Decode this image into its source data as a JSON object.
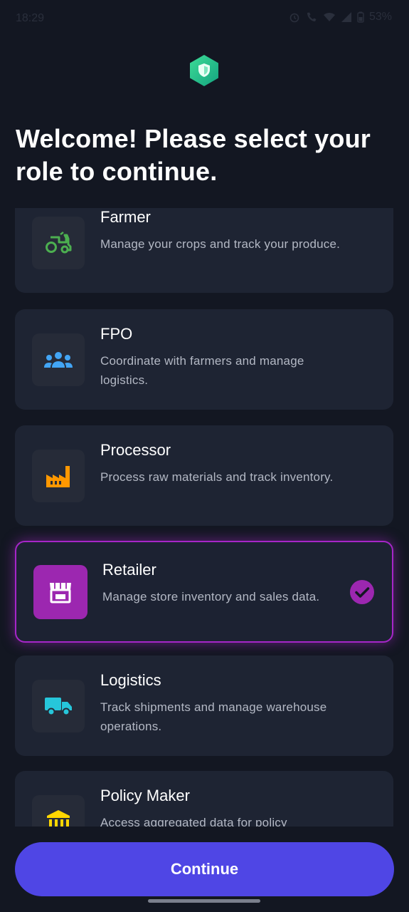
{
  "status_bar": {
    "time": "18:29",
    "battery": "53%",
    "icons": [
      "snapchat-icon",
      "alarm-icon",
      "wifi-call-icon",
      "wifi-icon",
      "signal-icon",
      "battery-icon"
    ]
  },
  "header": {
    "logo_icon": "shield-logo-icon",
    "title": "Welcome! Please select your role to continue."
  },
  "roles": [
    {
      "title": "Farmer",
      "description": "Manage your crops and track your produce.",
      "icon": "tractor-icon",
      "icon_color": "#4caf50",
      "selected": false
    },
    {
      "title": "FPO",
      "description": "Coordinate with farmers and manage logistics.",
      "icon": "group-icon",
      "icon_color": "#42a5f5",
      "selected": false
    },
    {
      "title": "Processor",
      "description": "Process raw materials and track inventory.",
      "icon": "factory-icon",
      "icon_color": "#ff9800",
      "selected": false
    },
    {
      "title": "Retailer",
      "description": "Manage store inventory and sales data.",
      "icon": "store-icon",
      "icon_color": "#ffffff",
      "selected": true
    },
    {
      "title": "Logistics",
      "description": "Track shipments and manage warehouse operations.",
      "icon": "truck-icon",
      "icon_color": "#26c6da",
      "selected": false
    },
    {
      "title": "Policy Maker",
      "description": "Access aggregated data for policy",
      "icon": "bank-icon",
      "icon_color": "#ffd600",
      "selected": false
    }
  ],
  "continue_button": {
    "label": "Continue"
  },
  "colors": {
    "background": "#131722",
    "card": "#1e2433",
    "accent": "#4f46e5",
    "selected_border": "#a626c8",
    "selected_icon_bg": "#9c27b0"
  }
}
